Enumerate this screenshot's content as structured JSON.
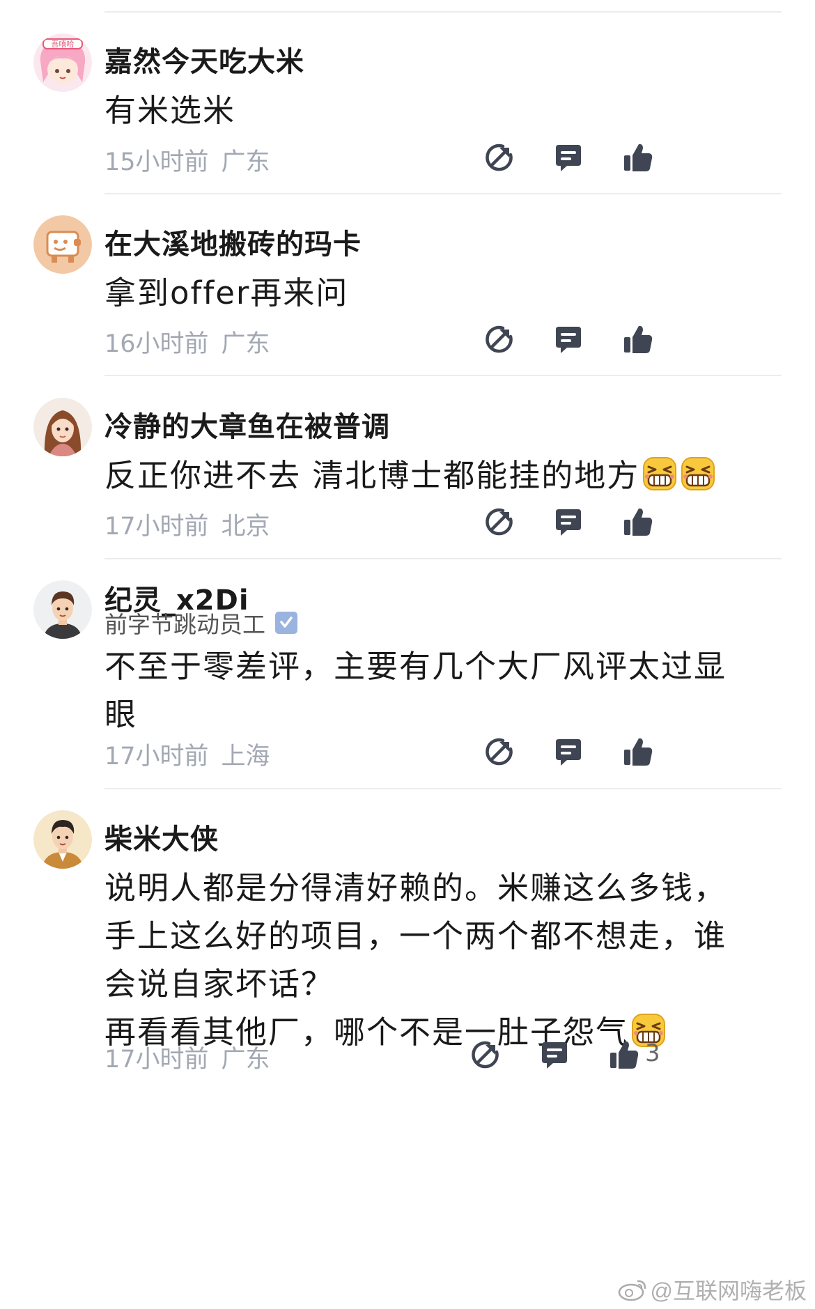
{
  "comments": [
    {
      "name": "嘉然今天吃大米",
      "body": "有米选米",
      "time": "15小时前",
      "location": "广东"
    },
    {
      "name": "在大溪地搬砖的玛卡",
      "body": "拿到offer再来问",
      "time": "16小时前",
      "location": "广东"
    },
    {
      "name": "冷静的大章鱼在被普调",
      "body": "反正你进不去 清北博士都能挂的地方",
      "time": "17小时前",
      "location": "北京"
    },
    {
      "name": "纪灵_x2Di",
      "title": "前字节跳动员工",
      "body_lines": [
        "不至于零差评，主要有几个大厂风评太过显",
        "眼"
      ],
      "time": "17小时前",
      "location": "上海"
    },
    {
      "name": "柴米大侠",
      "body_lines": [
        "说明人都是分得清好赖的。米赚这么多钱，",
        "手上这么好的项目，一个两个都不想走，谁",
        "会说自家坏话？",
        "再看看其他厂，哪个不是一肚子怨气"
      ],
      "time": "17小时前",
      "location": "广东",
      "like_count": "3"
    }
  ],
  "watermark": "@互联网嗨老板",
  "icons": {
    "share": "share-icon",
    "reply": "reply-icon",
    "like": "thumbs-up-icon",
    "emoji": "grin-emoji-icon",
    "verified": "verified-badge-icon"
  },
  "colors": {
    "meta_text": "#a2a8b3",
    "action_icon": "#3f4552",
    "verified_badge": "#9bb3df",
    "divider": "#ececef"
  }
}
